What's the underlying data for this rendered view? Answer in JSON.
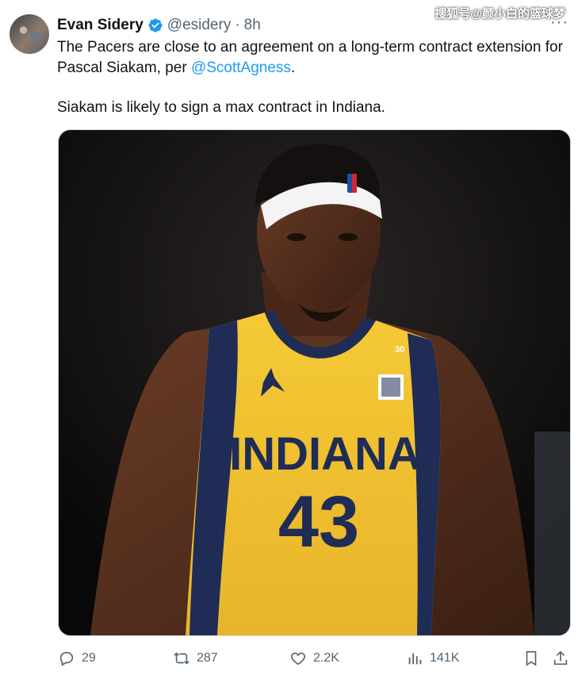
{
  "watermark": "搜狐号@颜小白的篮球梦",
  "author": {
    "name": "Evan Sidery",
    "handle": "@esidery",
    "separator": "·",
    "time": "8h",
    "avatar_icon": "user-avatar",
    "verified_icon": "verified-badge-icon"
  },
  "more_label": "···",
  "post": {
    "line1_prefix": "The Pacers are close to an agreement on a long-term contract extension for Pascal Siakam, per ",
    "mention": "@ScottAgness",
    "line1_suffix": ".",
    "line2": "Siakam is likely to sign a max contract in Indiana."
  },
  "media": {
    "jersey_team": "INDIANA",
    "jersey_number": "43",
    "strap_number": "30",
    "colors": {
      "jersey": "#f2c330",
      "trim": "#1f2c55",
      "background": "#0b0b0c"
    }
  },
  "actions": {
    "replies": "29",
    "reposts": "287",
    "likes": "2.2K",
    "views": "141K"
  },
  "colors": {
    "accent": "#1d9bf0",
    "muted": "#536471",
    "text": "#0f1419"
  }
}
